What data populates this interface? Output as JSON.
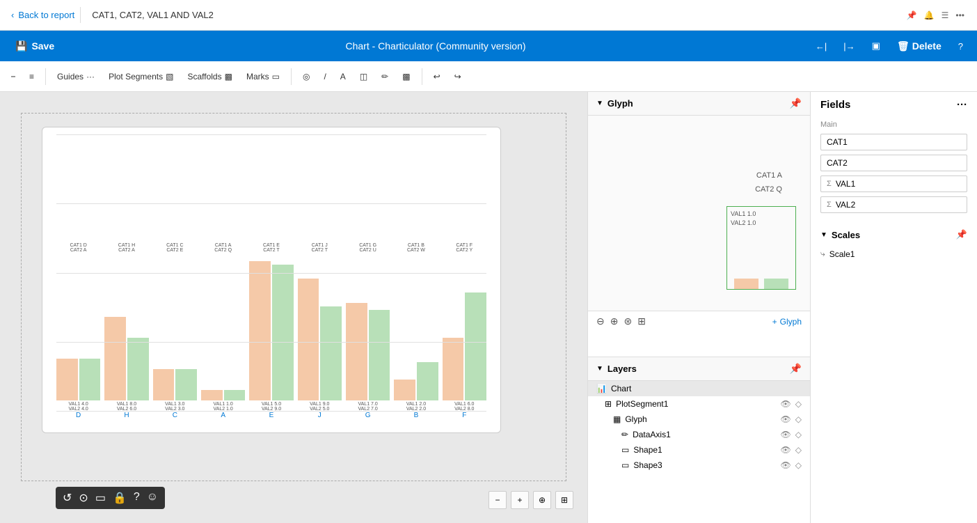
{
  "topbar": {
    "back_label": "Back to report",
    "tab_label": "CAT1, CAT2, VAL1 AND VAL2"
  },
  "appbar": {
    "save_label": "Save",
    "title": "Chart - Charticulator (Community version)",
    "delete_label": "Delete"
  },
  "toolbar": {
    "guides_label": "Guides",
    "plot_segments_label": "Plot Segments",
    "scaffolds_label": "Scaffolds",
    "marks_label": "Marks"
  },
  "chart": {
    "bar_groups": [
      {
        "cat1": "CAT1 D",
        "cat2": "CAT2 A",
        "val1": "VAL1 4.0",
        "val2": "VAL2 4.0",
        "x": "D",
        "h1": 60,
        "h2": 60
      },
      {
        "cat1": "CAT1 H",
        "cat2": "CAT2 A",
        "val1": "VAL1 8.0",
        "val2": "VAL2 6.0",
        "x": "H",
        "h1": 120,
        "h2": 90
      },
      {
        "cat1": "CAT1 C",
        "cat2": "CAT2 E",
        "val1": "VAL1 3.0",
        "val2": "VAL2 3.0",
        "x": "C",
        "h1": 45,
        "h2": 45
      },
      {
        "cat1": "CAT1 A",
        "cat2": "CAT2 Q",
        "val1": "VAL1 1.0",
        "val2": "VAL2 1.0",
        "x": "A",
        "h1": 15,
        "h2": 15
      },
      {
        "cat1": "CAT1 E",
        "cat2": "CAT2 T",
        "val1": "VAL1 5.0",
        "val2": "VAL2 9.0",
        "x": "E",
        "h1": 200,
        "h2": 195
      },
      {
        "cat1": "CAT1 J",
        "cat2": "CAT2 T",
        "val1": "VAL1 9.0",
        "val2": "VAL2 5.0",
        "x": "J",
        "h1": 175,
        "h2": 135
      },
      {
        "cat1": "CAT1 G",
        "cat2": "CAT2 U",
        "val1": "VAL1 7.0",
        "val2": "VAL2 7.0",
        "x": "G",
        "h1": 140,
        "h2": 130
      },
      {
        "cat1": "CAT1 B",
        "cat2": "CAT2 W",
        "val1": "VAL1 2.0",
        "val2": "VAL2 2.0",
        "x": "B",
        "h1": 30,
        "h2": 55
      },
      {
        "cat1": "CAT1 F",
        "cat2": "CAT2 Y",
        "val1": "VAL1 6.0",
        "val2": "VAL2 8.0",
        "x": "F",
        "h1": 90,
        "h2": 155
      }
    ]
  },
  "glyph": {
    "title": "Glyph",
    "labels": {
      "cat1": "CAT1 A",
      "cat2": "CAT2 Q",
      "val1": "VAL1 1.0",
      "val2": "VAL2 1.0"
    },
    "add_label": "Glyph"
  },
  "layers": {
    "title": "Layers",
    "items": [
      {
        "name": "Chart",
        "icon": "chart-icon",
        "indent": 0,
        "type": "chart"
      },
      {
        "name": "PlotSegment1",
        "icon": "grid-icon",
        "indent": 1,
        "type": "plot"
      },
      {
        "name": "Glyph",
        "icon": "glyph-icon",
        "indent": 2,
        "type": "glyph"
      },
      {
        "name": "DataAxis1",
        "icon": "axis-icon",
        "indent": 3,
        "type": "axis"
      },
      {
        "name": "Shape1",
        "icon": "shape-icon",
        "indent": 3,
        "type": "shape"
      },
      {
        "name": "Shape3",
        "icon": "shape-icon",
        "indent": 3,
        "type": "shape"
      }
    ]
  },
  "fields": {
    "title": "Fields",
    "section": "Main",
    "items": [
      {
        "name": "CAT1",
        "type": "text"
      },
      {
        "name": "CAT2",
        "type": "text"
      },
      {
        "name": "VAL1",
        "type": "sigma"
      },
      {
        "name": "VAL2",
        "type": "sigma"
      }
    ]
  },
  "scales": {
    "title": "Scales",
    "items": [
      {
        "name": "Scale1",
        "icon": "scale-icon"
      }
    ]
  },
  "canvas_toolbar": {
    "buttons": [
      "↺",
      "⊙",
      "▭",
      "🔒",
      "?",
      "☺"
    ]
  },
  "zoom": {
    "buttons": [
      "−",
      "+",
      "⊕",
      "⊞"
    ]
  }
}
